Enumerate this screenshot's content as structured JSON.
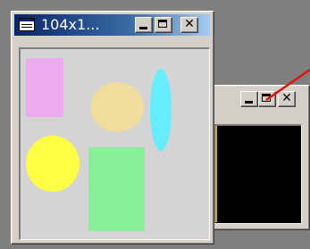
{
  "window_front": {
    "title": "104x1...",
    "buttons": [
      "minimize",
      "maximize",
      "close"
    ],
    "close_label": "✕",
    "canvas_bg": "#d4d4d4",
    "shapes": [
      {
        "name": "pink-rectangle",
        "color": "#eeaaee"
      },
      {
        "name": "tan-circle",
        "color": "#f0dc9c"
      },
      {
        "name": "cyan-ellipse",
        "color": "#66eeff"
      },
      {
        "name": "yellow-circle",
        "color": "#ffff44"
      },
      {
        "name": "green-rectangle",
        "color": "#88f099"
      }
    ]
  },
  "window_back": {
    "buttons": [
      "minimize",
      "maximize",
      "close"
    ],
    "close_label": "✕",
    "canvas_bg": "#000000"
  },
  "pointer": {
    "color": "#e01010"
  }
}
